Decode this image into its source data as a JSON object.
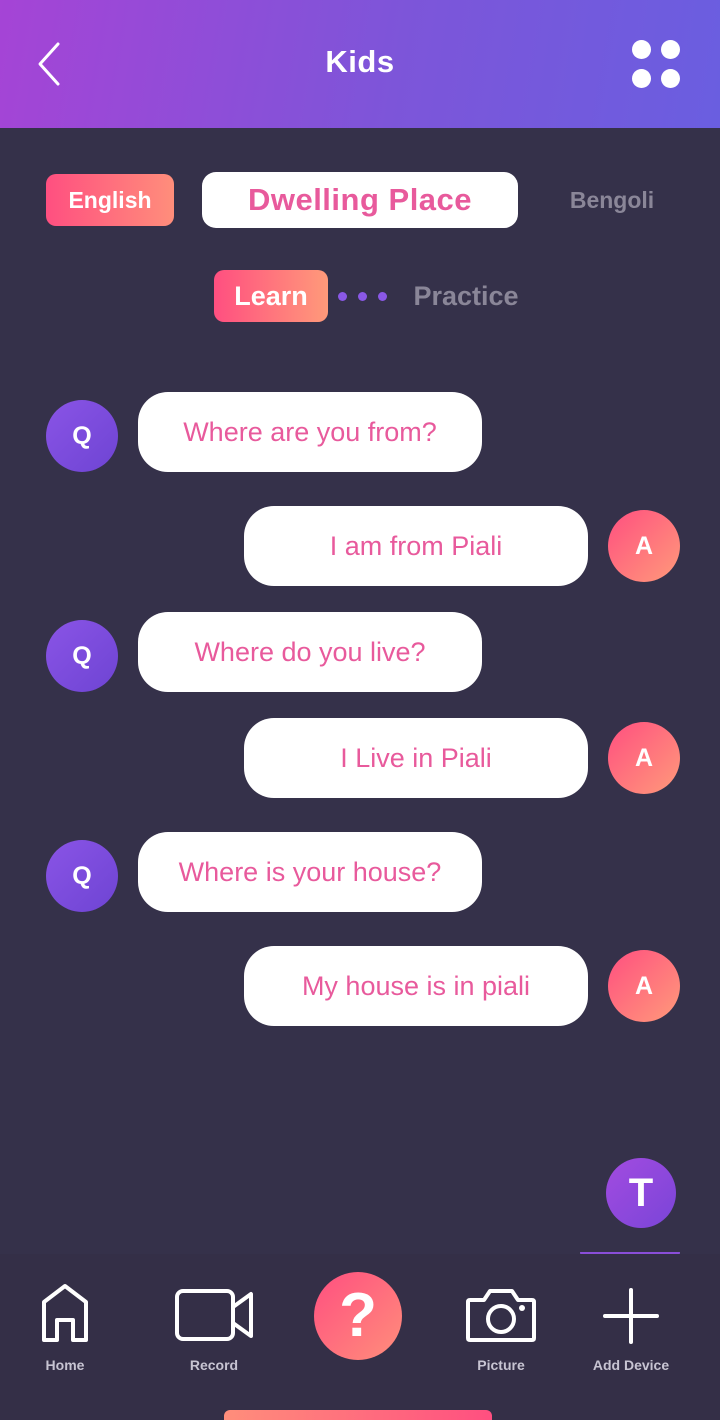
{
  "header": {
    "title": "Kids"
  },
  "languages": {
    "primary": "English",
    "topic": "Dwelling Place",
    "secondary": "Bengoli"
  },
  "tabs": {
    "learn": "Learn",
    "practice": "Practice"
  },
  "conversation": [
    {
      "role": "Q",
      "text": "Where are you from?"
    },
    {
      "role": "A",
      "text": "I am from Piali"
    },
    {
      "role": "Q",
      "text": "Where do you live?"
    },
    {
      "role": "A",
      "text": "I Live in Piali"
    },
    {
      "role": "Q",
      "text": "Where is your house?"
    },
    {
      "role": "A",
      "text": "My house is in piali"
    }
  ],
  "floating_button": {
    "label": "T"
  },
  "bottom_nav": {
    "home": {
      "label": "Home",
      "icon": "home-icon"
    },
    "record": {
      "label": "Record",
      "icon": "video-camera-icon"
    },
    "help": {
      "label": "?",
      "icon": "question-icon"
    },
    "picture": {
      "label": "Picture",
      "icon": "camera-icon"
    },
    "add_device": {
      "label": "Add Device",
      "icon": "plus-icon"
    }
  },
  "colors": {
    "background": "#35314a",
    "accent_pink": "#e85a9c",
    "gradient_coral_start": "#ff4f80",
    "gradient_coral_end": "#ff8e7b",
    "gradient_purple": "#7d55d9"
  }
}
